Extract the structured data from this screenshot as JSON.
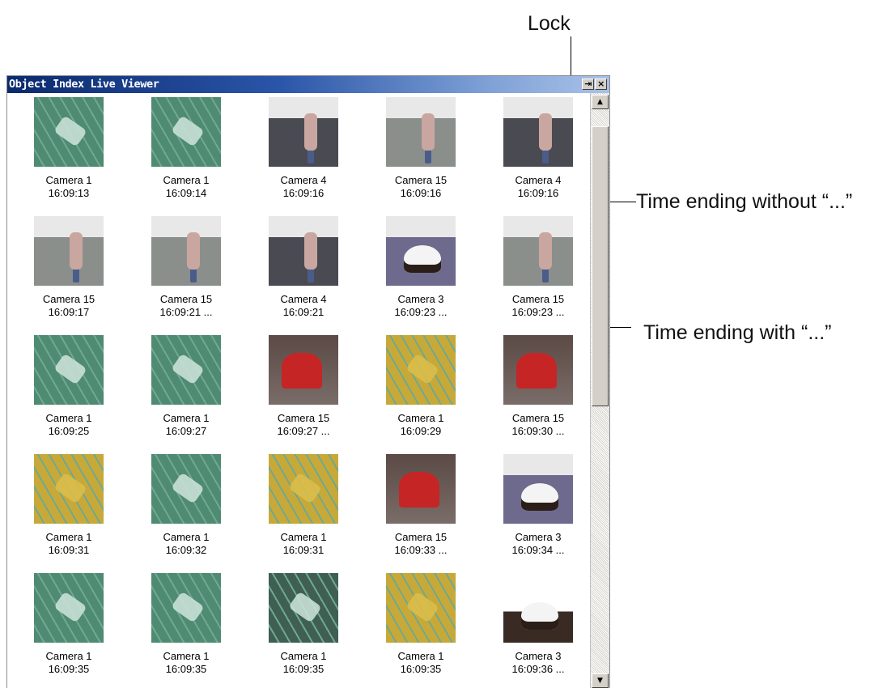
{
  "annotations": {
    "lock": "Lock",
    "time_without": "Time ending without “...”",
    "time_with": "Time ending with “...”"
  },
  "window": {
    "title": "Object Index Live Viewer",
    "lock_glyph": "⇥",
    "close_glyph": "×",
    "scroll_up": "▲",
    "scroll_down": "▼"
  },
  "items": [
    {
      "camera": "Camera 1",
      "time": "16:09:13",
      "scene": "street"
    },
    {
      "camera": "Camera 1",
      "time": "16:09:14",
      "scene": "street"
    },
    {
      "camera": "Camera 4",
      "time": "16:09:16",
      "scene": "office"
    },
    {
      "camera": "Camera 15",
      "time": "16:09:16",
      "scene": "lobby"
    },
    {
      "camera": "Camera 4",
      "time": "16:09:16",
      "scene": "office"
    },
    {
      "camera": "Camera 15",
      "time": "16:09:17",
      "scene": "lobby"
    },
    {
      "camera": "Camera 15",
      "time": "16:09:21 ...",
      "scene": "lobby"
    },
    {
      "camera": "Camera 4",
      "time": "16:09:21",
      "scene": "office"
    },
    {
      "camera": "Camera 3",
      "time": "16:09:23 ...",
      "scene": "desk"
    },
    {
      "camera": "Camera 15",
      "time": "16:09:23 ...",
      "scene": "lobby"
    },
    {
      "camera": "Camera 1",
      "time": "16:09:25",
      "scene": "street"
    },
    {
      "camera": "Camera 1",
      "time": "16:09:27",
      "scene": "street"
    },
    {
      "camera": "Camera 15",
      "time": "16:09:27 ...",
      "scene": "reading"
    },
    {
      "camera": "Camera 1",
      "time": "16:09:29",
      "scene": "street-yellow"
    },
    {
      "camera": "Camera 15",
      "time": "16:09:30 ...",
      "scene": "reading"
    },
    {
      "camera": "Camera 1",
      "time": "16:09:31",
      "scene": "street-yellow"
    },
    {
      "camera": "Camera 1",
      "time": "16:09:32",
      "scene": "street"
    },
    {
      "camera": "Camera 1",
      "time": "16:09:31",
      "scene": "street-yellow"
    },
    {
      "camera": "Camera 15",
      "time": "16:09:33 ...",
      "scene": "reading"
    },
    {
      "camera": "Camera 3",
      "time": "16:09:34 ...",
      "scene": "desk"
    },
    {
      "camera": "Camera 1",
      "time": "16:09:35",
      "scene": "street"
    },
    {
      "camera": "Camera 1",
      "time": "16:09:35",
      "scene": "street"
    },
    {
      "camera": "Camera 1",
      "time": "16:09:35",
      "scene": "street-dark"
    },
    {
      "camera": "Camera 1",
      "time": "16:09:35",
      "scene": "street-yellow"
    },
    {
      "camera": "Camera 3",
      "time": "16:09:36 ...",
      "scene": "desk-close"
    }
  ],
  "colors": {
    "street": "#4f8a73",
    "street-yellow": "#c7a93a",
    "street-dark": "#3f5f55",
    "office": "#4a4a52",
    "lobby": "#8a8f8c",
    "desk": "#6e6a8e",
    "reading": "#b22a2a",
    "desk-close": "#ffffff"
  }
}
